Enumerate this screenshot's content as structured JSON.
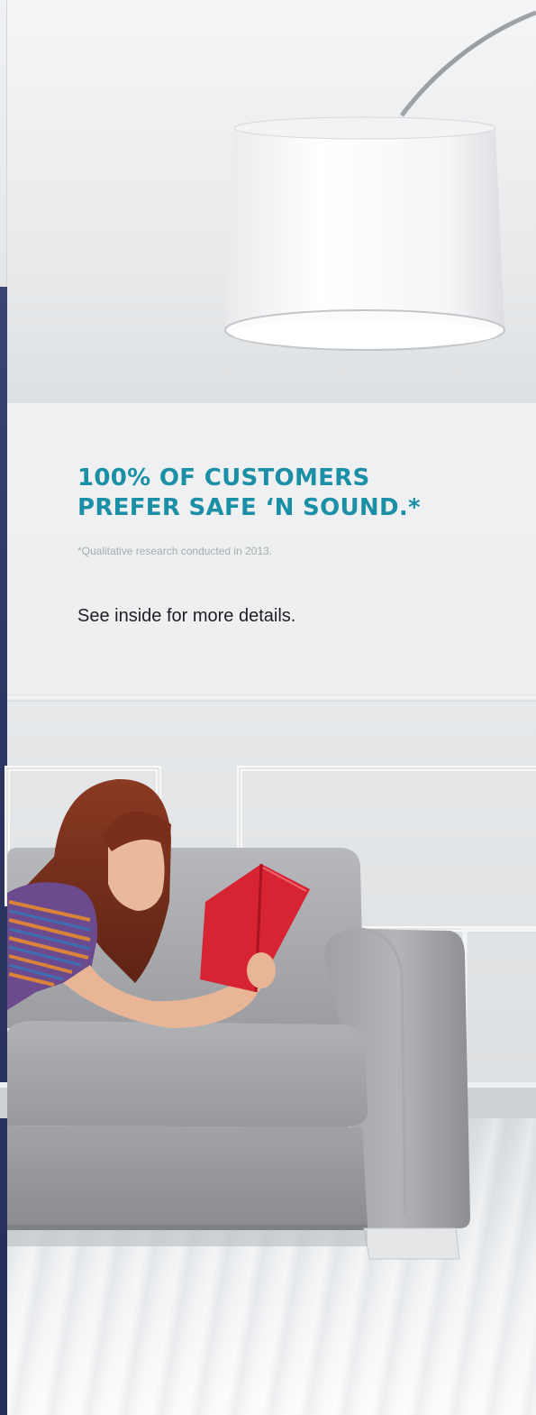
{
  "headline": {
    "line1": "100% OF CUSTOMERS",
    "line2": "PREFER SAFE ‘N SOUND.*"
  },
  "footnote": "*Qualitative research conducted in 2013.",
  "details": "See inside for more details.",
  "colors": {
    "headline": "#1b8fa6",
    "spine": "#2c3561",
    "book": "#d62433",
    "sofa": "#a6a7aa"
  }
}
